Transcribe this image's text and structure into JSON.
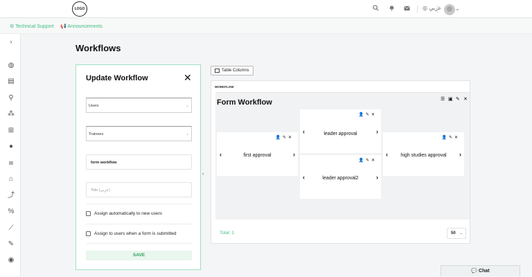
{
  "header": {
    "logo_text": "LOGO",
    "lang_label": "عربي",
    "icons": [
      "search-icon",
      "bell-icon",
      "mail-icon",
      "globe-icon",
      "user-avatar",
      "chevron-down-icon"
    ]
  },
  "subnav": {
    "technical_support": "Technical Support",
    "announcements": "Announcements"
  },
  "sidebar": {
    "icons": [
      "expand-icon",
      "globe-icon",
      "book-icon",
      "person-icon",
      "group-icon",
      "table-icon",
      "user-icon",
      "hierarchy-icon",
      "building-icon",
      "arrow-up-icon",
      "percent-icon",
      "chart-icon",
      "pen-icon",
      "palette-icon"
    ]
  },
  "page": {
    "title": "Workflows"
  },
  "update_panel": {
    "title": "Update Workflow",
    "close_glyph": "✕",
    "users_select": "Users",
    "trainees_select": "Trainees",
    "name_value": "form workflow",
    "title_placeholder": "Title (عربي)",
    "assign_auto_label": "Assign automatically to new users",
    "assign_submit_label": "Assign to users when a form is submitted",
    "save_label": "SAVE"
  },
  "table_columns_label": "Table Columns",
  "workflow": {
    "header": "WORKFLOW",
    "form_title": "Form Workflow",
    "nodes": {
      "first": "first approval",
      "leader": "leader approval",
      "leader2": "leader approval2",
      "high": "high studies approval"
    }
  },
  "footer": {
    "total": "Total: 1",
    "page_size": "50"
  },
  "chat_label": "Chat",
  "colors": {
    "accent_green": "#3fbf7f",
    "panel_border": "#9fe0c3",
    "save_bg": "#e9f7ee"
  }
}
